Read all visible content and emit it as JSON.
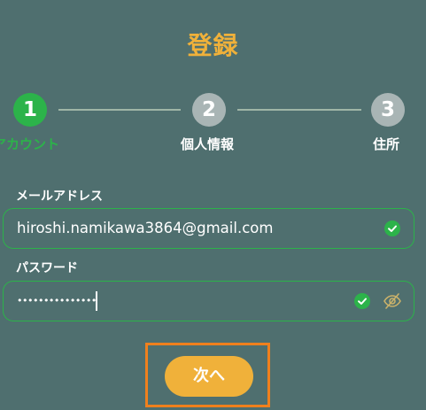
{
  "page": {
    "title": "登録"
  },
  "stepper": {
    "steps": [
      {
        "number": "1",
        "label": "アカウント",
        "state": "active"
      },
      {
        "number": "2",
        "label": "個人情報",
        "state": "inactive"
      },
      {
        "number": "3",
        "label": "住所",
        "state": "inactive"
      }
    ]
  },
  "form": {
    "email": {
      "label": "メールアドレス",
      "value": "hiroshi.namikawa3864@gmail.com",
      "valid": true
    },
    "password": {
      "label": "パスワード",
      "masked_value": "•••••••••••••••",
      "valid": true,
      "visibility_icon": "eye-slash-icon"
    }
  },
  "actions": {
    "next_label": "次へ"
  },
  "colors": {
    "background": "#4f6f6f",
    "accent": "#f0b13a",
    "success": "#2cb34a",
    "step_inactive": "#a9b5b5",
    "highlight": "#f0801d"
  }
}
